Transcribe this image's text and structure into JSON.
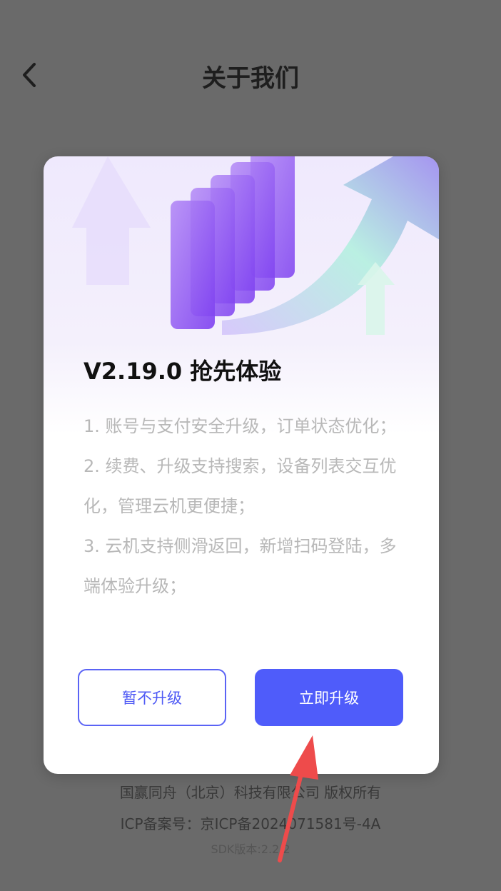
{
  "header": {
    "back_icon": "chevron-left-icon",
    "title": "关于我们"
  },
  "footer": {
    "copyright": "国赢同舟（北京）科技有限公司 版权所有",
    "icp": "ICP备案号：京ICP备2024071581号-4A",
    "sdk": "SDK版本:2.2.2"
  },
  "dialog": {
    "title": "V2.19.0 抢先体验",
    "notes": [
      "1. 账号与支付安全升级，订单状态优化；",
      "2. 续费、升级支持搜索，设备列表交互优化，管理云机更便捷；",
      "3. 云机支持侧滑返回，新增扫码登陆，多端体验升级；"
    ],
    "later_label": "暂不升级",
    "upgrade_label": "立即升级"
  },
  "annotation": {
    "arrow_icon": "red-pointer-arrow-icon",
    "color": "#ee4b4b"
  },
  "colors": {
    "primary": "#4f5cfa",
    "overlay": "#6a6a6a"
  }
}
